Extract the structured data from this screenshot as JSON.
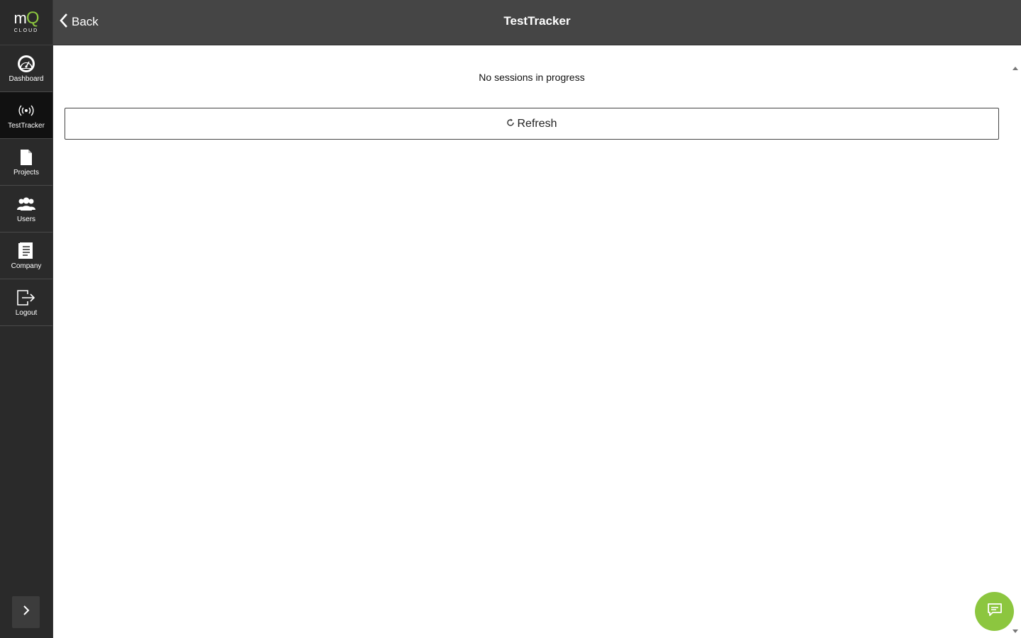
{
  "brand": {
    "logo_text": "mQ",
    "logo_subtext": "CLOUD",
    "accent_color": "#8cc63f"
  },
  "sidebar": {
    "items": [
      {
        "label": "Dashboard",
        "icon": "dashboard-gauge-icon"
      },
      {
        "label": "TestTracker",
        "icon": "broadcast-icon",
        "active": true
      },
      {
        "label": "Projects",
        "icon": "document-icon"
      },
      {
        "label": "Users",
        "icon": "users-icon"
      },
      {
        "label": "Company",
        "icon": "company-document-icon"
      },
      {
        "label": "Logout",
        "icon": "logout-icon"
      }
    ],
    "expand_icon": "chevron-right-icon"
  },
  "header": {
    "back_label": "Back",
    "title": "TestTracker"
  },
  "main": {
    "status_text": "No sessions in progress",
    "refresh_label": "Refresh"
  },
  "chat": {
    "icon": "chat-icon"
  }
}
